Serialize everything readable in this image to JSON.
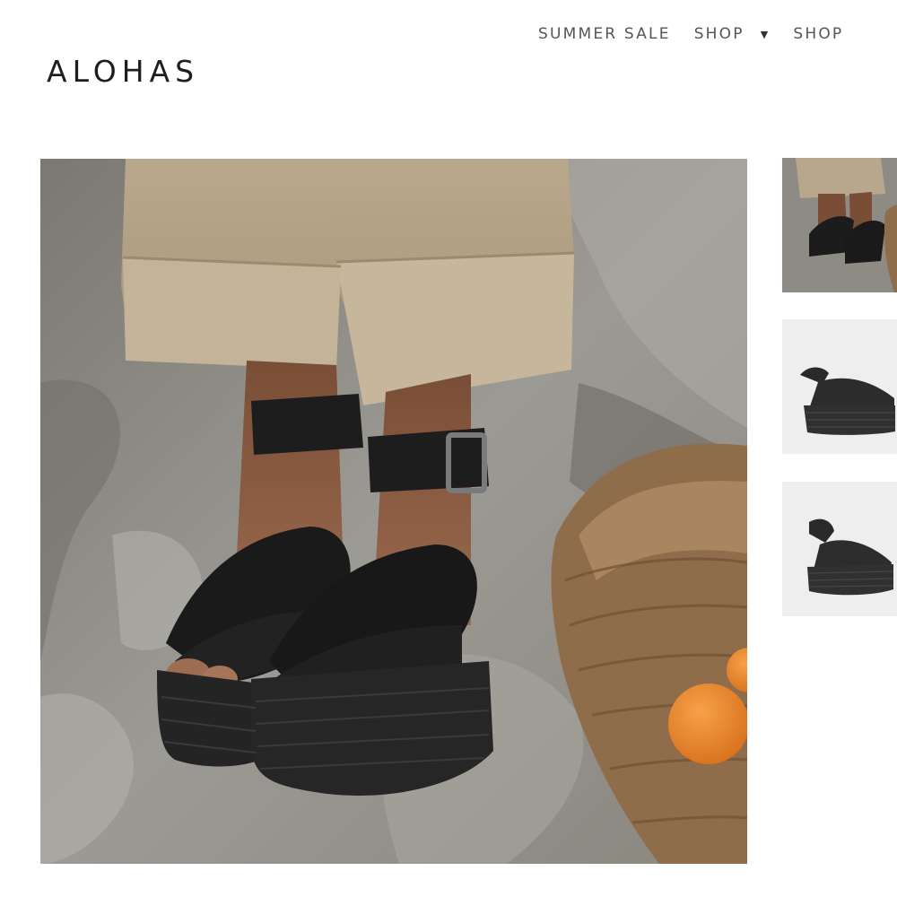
{
  "header": {
    "logo": "ALOHAS",
    "nav": [
      {
        "label": "SUMMER SALE"
      },
      {
        "label": "SHOP",
        "icon": "caret-down-icon",
        "caret": "▼"
      },
      {
        "label": "SHOP"
      }
    ]
  },
  "gallery": {
    "main_image": "black-platform-sandals-lifestyle-photo",
    "thumbnails": [
      {
        "image": "sandals-lifestyle-thumbnail"
      },
      {
        "image": "sandal-side-view-thumbnail"
      },
      {
        "image": "sandal-angle-view-thumbnail"
      }
    ]
  },
  "colors": {
    "text": "#1e1e1e",
    "nav_text": "#555555",
    "thumb_bg": "#eeeeee",
    "sandal": "#1c1c1c",
    "linen": "#bba98e"
  }
}
